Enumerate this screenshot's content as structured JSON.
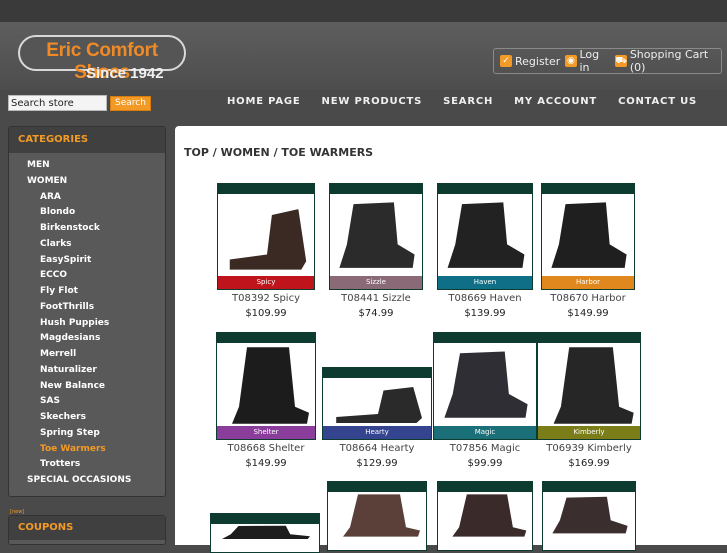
{
  "brand": {
    "name": "Eric Comfort Shoes",
    "tagline": "Since 1942"
  },
  "account": {
    "register": "Register",
    "login": "Log in",
    "cart": "Shopping Cart (0)"
  },
  "search": {
    "placeholder": "Search store",
    "button": "Search"
  },
  "nav": [
    "HOME PAGE",
    "NEW PRODUCTS",
    "SEARCH",
    "MY ACCOUNT",
    "CONTACT US"
  ],
  "sidebar": {
    "title": "CATEGORIES",
    "items": [
      {
        "label": "MEN",
        "level": 0
      },
      {
        "label": "WOMEN",
        "level": 0
      },
      {
        "label": "ARA",
        "level": 1
      },
      {
        "label": "Blondo",
        "level": 1
      },
      {
        "label": "Birkenstock",
        "level": 1
      },
      {
        "label": "Clarks",
        "level": 1
      },
      {
        "label": "EasySpirit",
        "level": 1
      },
      {
        "label": "ECCO",
        "level": 1
      },
      {
        "label": "Fly Flot",
        "level": 1
      },
      {
        "label": "FootThrills",
        "level": 1
      },
      {
        "label": "Hush Puppies",
        "level": 1
      },
      {
        "label": "Magdesians",
        "level": 1
      },
      {
        "label": "Merrell",
        "level": 1
      },
      {
        "label": "Naturalizer",
        "level": 1
      },
      {
        "label": "New Balance",
        "level": 1
      },
      {
        "label": "SAS",
        "level": 1
      },
      {
        "label": "Skechers",
        "level": 1
      },
      {
        "label": "Spring Step",
        "level": 1
      },
      {
        "label": "Toe Warmers",
        "level": 1,
        "active": true
      },
      {
        "label": "Trotters",
        "level": 1
      },
      {
        "label": "SPECIAL OCCASIONS",
        "level": 0
      }
    ],
    "mini_label": "[new]"
  },
  "coupons": {
    "title": "COUPONS"
  },
  "breadcrumb": "TOP / WOMEN / TOE WARMERS",
  "products": [
    {
      "name": "T08392 Spicy",
      "price": "$109.99",
      "tag": "Spicy",
      "tag_color": "#c0141c",
      "shoe_color": "#3b2a24",
      "style": "low"
    },
    {
      "name": "T08441 Sizzle",
      "price": "$74.99",
      "tag": "Sizzle",
      "tag_color": "#8a6a76",
      "shoe_color": "#2b2b2b",
      "style": "boot"
    },
    {
      "name": "T08669 Haven",
      "price": "$139.99",
      "tag": "Haven",
      "tag_color": "#0e6f87",
      "shoe_color": "#222222",
      "style": "boot"
    },
    {
      "name": "T08670 Harbor",
      "price": "$149.99",
      "tag": "Harbor",
      "tag_color": "#e0871d",
      "shoe_color": "#1f1f1f",
      "style": "boot"
    },
    {
      "name": "T08668 Shelter",
      "price": "$149.99",
      "tag": "Shelter",
      "tag_color": "#8a3d9a",
      "shoe_color": "#1c1c1c",
      "style": "tall"
    },
    {
      "name": "T08664 Hearty",
      "price": "$129.99",
      "tag": "Hearty",
      "tag_color": "#34448e",
      "shoe_color": "#2a2a2a",
      "style": "low"
    },
    {
      "name": "T07856 Magic",
      "price": "$99.99",
      "tag": "Magic",
      "tag_color": "#1a6f78",
      "shoe_color": "#2e2e34",
      "style": "boot"
    },
    {
      "name": "T06939 Kimberly",
      "price": "$169.99",
      "tag": "Kimberly",
      "tag_color": "#7a7d18",
      "shoe_color": "#262626",
      "style": "tall"
    },
    {
      "name": "",
      "price": "",
      "tag": "",
      "tag_color": "#0d3b30",
      "shoe_color": "#1d1d1d",
      "style": "boot"
    },
    {
      "name": "",
      "price": "",
      "tag": "",
      "tag_color": "#0d3b30",
      "shoe_color": "#5a4038",
      "style": "tall"
    },
    {
      "name": "",
      "price": "",
      "tag": "",
      "tag_color": "#0d3b30",
      "shoe_color": "#3a2a2a",
      "style": "tall"
    },
    {
      "name": "",
      "price": "",
      "tag": "",
      "tag_color": "#0d3b30",
      "shoe_color": "#3a2e2e",
      "style": "boot"
    }
  ]
}
